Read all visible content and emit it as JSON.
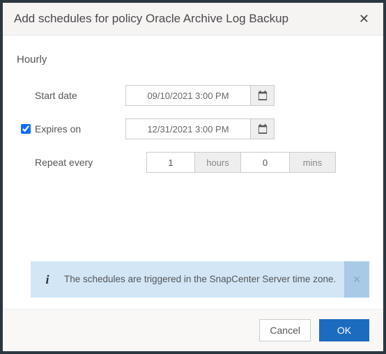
{
  "header": {
    "title": "Add schedules for policy Oracle Archive Log Backup"
  },
  "section_title": "Hourly",
  "fields": {
    "start_date": {
      "label": "Start date",
      "value": "09/10/2021 3:00 PM"
    },
    "expires_on": {
      "label": "Expires on",
      "value": "12/31/2021 3:00 PM",
      "checked": true
    },
    "repeat": {
      "label": "Repeat every",
      "hours_value": "1",
      "hours_unit": "hours",
      "mins_value": "0",
      "mins_unit": "mins"
    }
  },
  "info": {
    "text": "The schedules are triggered in the SnapCenter Server time zone."
  },
  "footer": {
    "cancel": "Cancel",
    "ok": "OK"
  }
}
